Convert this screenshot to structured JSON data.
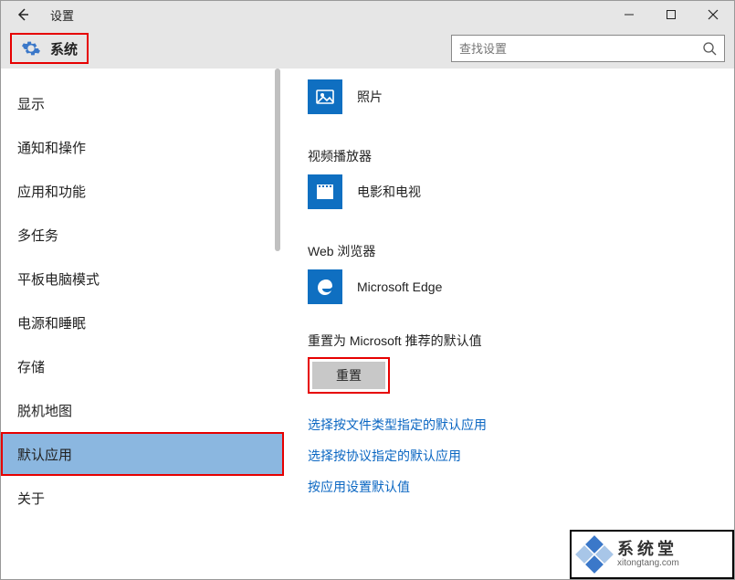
{
  "titlebar": {
    "title": "设置"
  },
  "toolbar": {
    "system_label": "系统"
  },
  "search": {
    "placeholder": "查找设置"
  },
  "sidebar": {
    "items": [
      {
        "label": "显示"
      },
      {
        "label": "通知和操作"
      },
      {
        "label": "应用和功能"
      },
      {
        "label": "多任务"
      },
      {
        "label": "平板电脑模式"
      },
      {
        "label": "电源和睡眠"
      },
      {
        "label": "存储"
      },
      {
        "label": "脱机地图"
      },
      {
        "label": "默认应用"
      },
      {
        "label": "关于"
      }
    ]
  },
  "main": {
    "photos": {
      "name": "照片"
    },
    "video": {
      "section": "视频播放器",
      "app": "电影和电视"
    },
    "web": {
      "section": "Web 浏览器",
      "app": "Microsoft Edge"
    },
    "reset": {
      "label": "重置为 Microsoft 推荐的默认值",
      "button": "重置"
    },
    "links": [
      "选择按文件类型指定的默认应用",
      "选择按协议指定的默认应用",
      "按应用设置默认值"
    ]
  },
  "watermark": {
    "cn": "系统堂",
    "url": "xitongtang.com"
  }
}
